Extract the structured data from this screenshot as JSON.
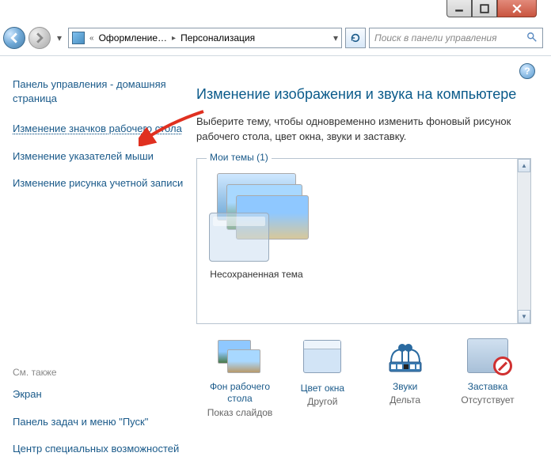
{
  "address": {
    "crumb1": "Оформление…",
    "crumb2": "Персонализация"
  },
  "search": {
    "placeholder": "Поиск в панели управления"
  },
  "sidebar": {
    "home": "Панель управления - домашняя страница",
    "links": [
      "Изменение значков рабочего стола",
      "Изменение указателей мыши",
      "Изменение рисунка учетной записи"
    ],
    "seealso": "См. также",
    "bottom": [
      "Экран",
      "Панель задач и меню \"Пуск\"",
      "Центр специальных возможностей"
    ]
  },
  "main": {
    "title": "Изменение изображения и звука на компьютере",
    "desc": "Выберите тему, чтобы одновременно изменить фоновый рисунок рабочего стола, цвет окна, звуки и заставку.",
    "themes_legend": "Мои темы (1)",
    "theme_name": "Несохраненная тема"
  },
  "options": {
    "bg": {
      "label": "Фон рабочего стола",
      "sub": "Показ слайдов"
    },
    "color": {
      "label": "Цвет окна",
      "sub": "Другой"
    },
    "sound": {
      "label": "Звуки",
      "sub": "Дельта"
    },
    "saver": {
      "label": "Заставка",
      "sub": "Отсутствует"
    }
  }
}
